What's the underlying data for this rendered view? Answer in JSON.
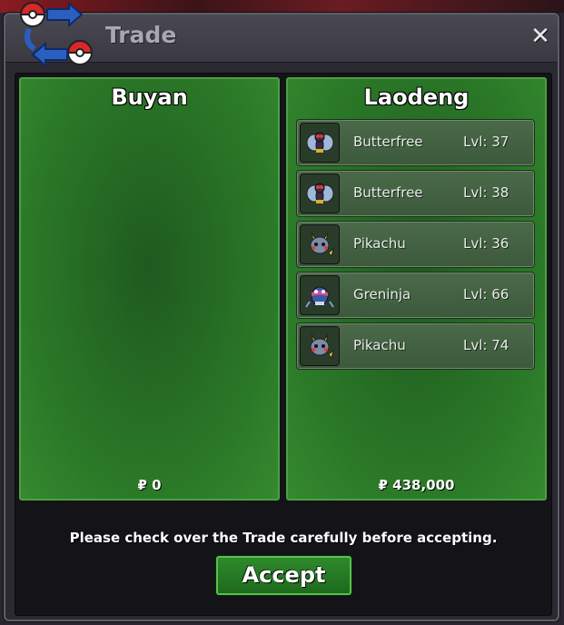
{
  "window": {
    "title": "Trade",
    "close_label": "✕"
  },
  "left_panel": {
    "player_name": "Buyan",
    "money": "₽ 0",
    "pokemon": []
  },
  "right_panel": {
    "player_name": "Laodeng",
    "money": "₽ 438,000",
    "pokemon": [
      {
        "name": "Butterfree",
        "level": "Lvl: 37",
        "icon": "butterfree-icon"
      },
      {
        "name": "Butterfree",
        "level": "Lvl: 38",
        "icon": "butterfree-icon"
      },
      {
        "name": "Pikachu",
        "level": "Lvl: 36",
        "icon": "pikachu-icon"
      },
      {
        "name": "Greninja",
        "level": "Lvl: 66",
        "icon": "greninja-icon"
      },
      {
        "name": "Pikachu",
        "level": "Lvl: 74",
        "icon": "pikachu-icon"
      }
    ]
  },
  "footer": {
    "notice": "Please check over the Trade carefully before accepting.",
    "accept_label": "Accept"
  },
  "colors": {
    "panel_green": "#2b7a28",
    "panel_border": "#4aa044",
    "accept_green": "#2f8a2c",
    "window_bg": "#2b2a33"
  }
}
